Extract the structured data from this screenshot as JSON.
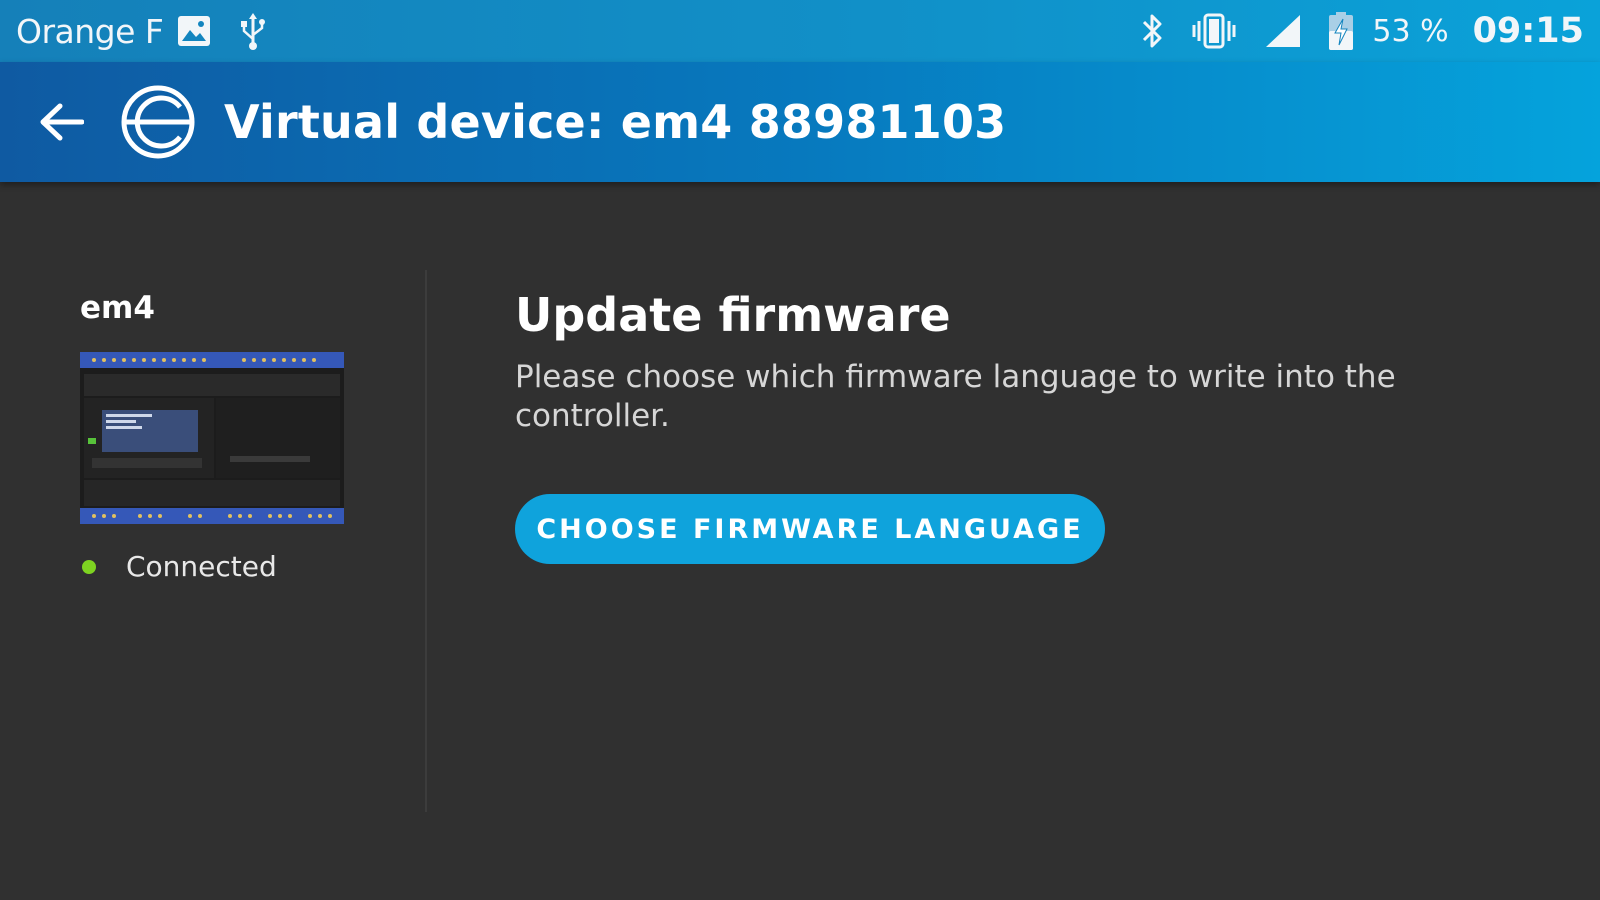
{
  "status_bar": {
    "carrier": "Orange F",
    "battery_percent": "53 %",
    "time": "09:15",
    "icons": [
      "image-icon",
      "usb-icon",
      "bluetooth-icon",
      "vibrate-icon",
      "signal-icon",
      "battery-charging-icon"
    ]
  },
  "app_bar": {
    "title": "Virtual device: em4 88981103",
    "back_icon": "arrow-left-icon",
    "logo_icon": "app-logo-icon"
  },
  "device": {
    "name": "em4",
    "status": "Connected",
    "status_color": "#7ed321"
  },
  "main": {
    "title": "Update firmware",
    "description": "Please choose which firmware language to write into the controller.",
    "button_label": "CHOOSE FIRMWARE LANGUAGE"
  },
  "colors": {
    "accent": "#0fa3dc",
    "background": "#303030",
    "header_start": "#0f5aa2",
    "header_end": "#05a3dc"
  }
}
